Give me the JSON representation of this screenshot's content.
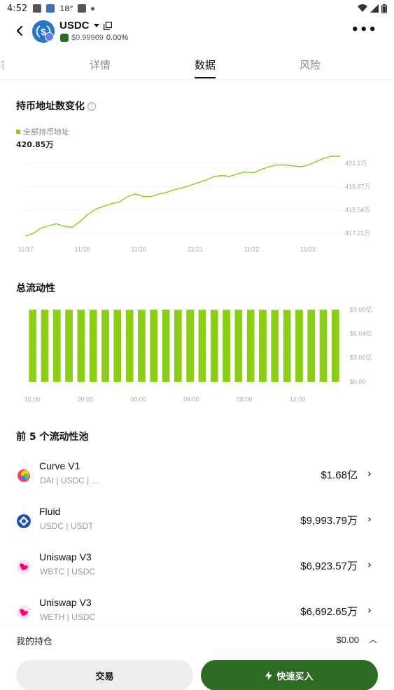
{
  "status_bar": {
    "time": "4:52",
    "temperature": "18°"
  },
  "header": {
    "token_symbol": "USDC",
    "price": "$0.99969",
    "change": "0.00%",
    "more_label": "•••"
  },
  "tabs": [
    {
      "label": "详情",
      "active": false
    },
    {
      "label": "数据",
      "active": true
    },
    {
      "label": "风险",
      "active": false
    }
  ],
  "holders_section": {
    "title": "持币地址数变化",
    "legend_label": "全部持币地址",
    "current_value": "420.85万"
  },
  "liquidity_section": {
    "title": "总流动性"
  },
  "chart_data": [
    {
      "type": "line",
      "series": [
        {
          "name": "全部持币地址",
          "color": "#8ccd16"
        }
      ],
      "x_ticks": [
        "11/17",
        "11/18",
        "11/20",
        "11/21",
        "11/22",
        "11/23"
      ],
      "y_ticks": [
        "421.2万",
        "419.87万",
        "418.54万",
        "417.21万"
      ],
      "ylim": [
        417.21,
        421.2
      ],
      "x": [
        0,
        1,
        2,
        3,
        4,
        5,
        6,
        7,
        8,
        9,
        10,
        11,
        12,
        13,
        14,
        15,
        16,
        17,
        18,
        19,
        20,
        21,
        22,
        23,
        24,
        25,
        26,
        27,
        28,
        29,
        30,
        31,
        32,
        33,
        34,
        35,
        36,
        37,
        38,
        39,
        40
      ],
      "values": [
        417.05,
        417.2,
        417.5,
        417.65,
        417.75,
        417.6,
        417.55,
        417.9,
        418.3,
        418.6,
        418.75,
        418.9,
        419.0,
        419.3,
        419.45,
        419.3,
        419.3,
        419.45,
        419.55,
        419.7,
        419.8,
        419.95,
        420.1,
        420.25,
        420.45,
        420.5,
        420.45,
        420.6,
        420.7,
        420.65,
        420.85,
        421.0,
        421.1,
        421.1,
        421.05,
        421.0,
        421.1,
        421.3,
        421.5,
        421.6,
        421.6
      ],
      "grid": true
    },
    {
      "type": "bar",
      "series": [
        {
          "color": "#8ccd16"
        }
      ],
      "x_ticks": [
        "16:00",
        "20:00",
        "00:00",
        "04:00",
        "08:00",
        "12:00"
      ],
      "y_ticks": [
        "$9.05亿",
        "$6.04亿",
        "$3.02亿",
        "$0.00"
      ],
      "ylim": [
        0,
        9.05
      ],
      "unit": "亿",
      "values": [
        9.03,
        9.03,
        9.03,
        9.03,
        9.03,
        9.03,
        9.02,
        9.02,
        9.02,
        9.03,
        9.04,
        9.04,
        9.03,
        9.03,
        9.02,
        9.02,
        9.03,
        9.03,
        9.02,
        9.02,
        9.0,
        9.01,
        9.02,
        9.03,
        9.03,
        9.03
      ],
      "grid": true
    }
  ],
  "pools_section": {
    "title": "前 5 个流动性池",
    "items": [
      {
        "name": "Curve V1",
        "pair": "DAI | USDC | ...",
        "value": "$1.68亿",
        "icon": "curve-icon"
      },
      {
        "name": "Fluid",
        "pair": "USDC | USDT",
        "value": "$9,993.79万",
        "icon": "fluid-icon"
      },
      {
        "name": "Uniswap V3",
        "pair": "WBTC | USDC",
        "value": "$6,923.57万",
        "icon": "uniswap-icon"
      },
      {
        "name": "Uniswap V3",
        "pair": "WETH | USDC",
        "value": "$6,692.65万",
        "icon": "uniswap-icon"
      }
    ]
  },
  "bottom": {
    "holding_label": "我的持仓",
    "holding_value": "$0.00",
    "trade_label": "交易",
    "buy_label": "快速买入"
  },
  "colors": {
    "accent_green": "#8ccd16",
    "buy_button": "#2d6b24",
    "usdc_blue": "#2775ca"
  }
}
